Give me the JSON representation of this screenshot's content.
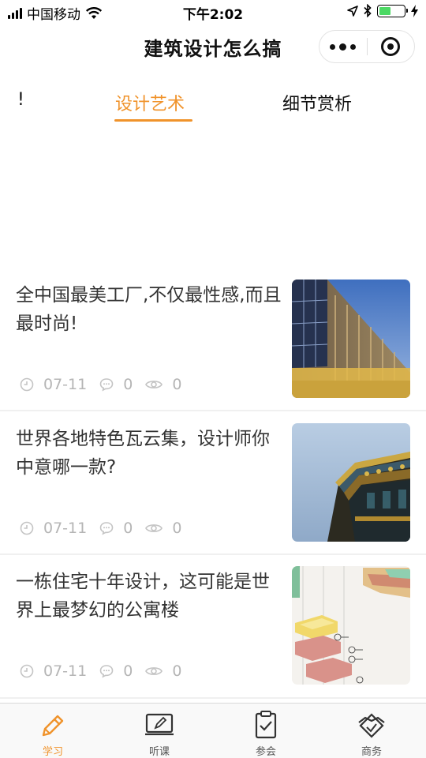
{
  "status_bar": {
    "carrier": "中国移动",
    "time": "下午2:02"
  },
  "nav": {
    "title": "建筑设计怎么搞"
  },
  "tabs": [
    {
      "label": "!",
      "active": false
    },
    {
      "label": "设计艺术",
      "active": true
    },
    {
      "label": "细节赏析",
      "active": false
    }
  ],
  "articles": [
    {
      "title": "全中国最美工厂,不仅最性感,而且最时尚!",
      "date": "07-11",
      "comments": "0",
      "views": "0"
    },
    {
      "title": "世界各地特色瓦云集，设计师你中意哪一款?",
      "date": "07-11",
      "comments": "0",
      "views": "0"
    },
    {
      "title": "一栋住宅十年设计，这可能是世界上最梦幻的公寓楼",
      "date": "07-11",
      "comments": "0",
      "views": "0"
    }
  ],
  "tabbar": [
    {
      "label": "学习",
      "icon": "pencil-icon",
      "active": true
    },
    {
      "label": "听课",
      "icon": "presentation-icon",
      "active": false
    },
    {
      "label": "参会",
      "icon": "checklist-icon",
      "active": false
    },
    {
      "label": "商务",
      "icon": "handshake-icon",
      "active": false
    }
  ],
  "colors": {
    "accent": "#f0932b",
    "meta_text": "#b5b5b5",
    "title_text": "#333333"
  }
}
